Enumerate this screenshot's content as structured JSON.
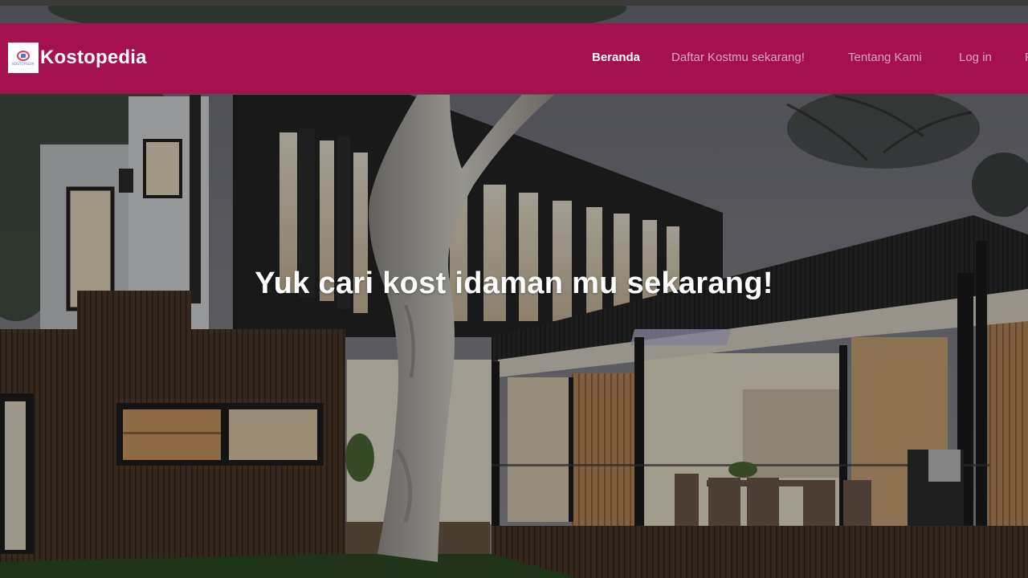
{
  "brand": {
    "name": "Kostopedia",
    "logo_text": "KOSTOPEDIA",
    "color": "#a5104f"
  },
  "nav": {
    "items": [
      {
        "label": "Beranda",
        "active": true
      },
      {
        "label": "Daftar Kostmu sekarang!",
        "active": false
      },
      {
        "label": "Tentang Kami",
        "active": false
      },
      {
        "label": "Log in",
        "active": false
      },
      {
        "label": "R",
        "active": false
      }
    ]
  },
  "hero": {
    "headline": "Yuk cari kost idaman mu sekarang!",
    "background": "modern-house-photo"
  },
  "icons": {
    "logo": "house-logo-icon"
  }
}
